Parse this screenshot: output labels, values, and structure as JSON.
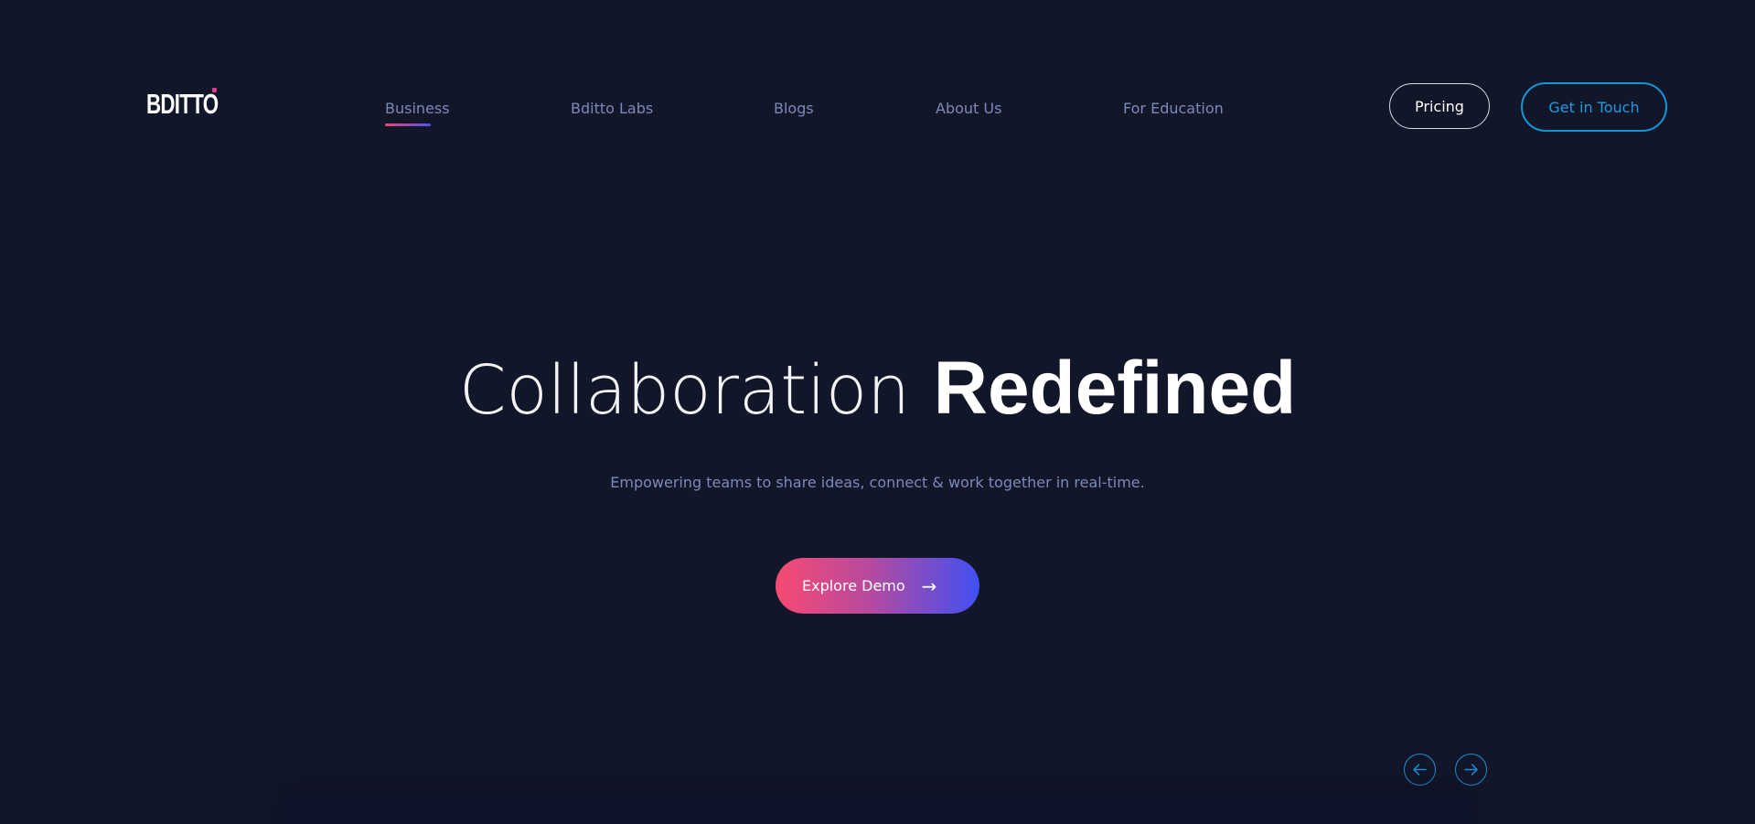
{
  "brand": {
    "logo_text": "BDITTO",
    "accent_dot_color": "#e03b8a"
  },
  "nav": {
    "items": [
      {
        "label": "Business",
        "active": true
      },
      {
        "label": "Bditto Labs",
        "active": false
      },
      {
        "label": "Blogs",
        "active": false
      },
      {
        "label": "About Us",
        "active": false
      },
      {
        "label": "For Education",
        "active": false
      }
    ]
  },
  "header_actions": {
    "pricing_label": "Pricing",
    "contact_label": "Get in Touch"
  },
  "hero": {
    "title_light": "Collaboration",
    "title_bold": "Redefined",
    "subtitle": "Empowering teams to share ideas, connect & work together in real-time.",
    "cta_label": "Explore Demo",
    "cta_arrow": "→"
  },
  "carousel": {
    "prev_icon": "arrow-left-icon",
    "next_icon": "arrow-right-icon"
  },
  "colors": {
    "background": "#121629",
    "nav_text": "#7d89b8",
    "accent_blue": "#1e9be0",
    "gradient_start": "#f74a72",
    "gradient_end": "#4150f2"
  }
}
